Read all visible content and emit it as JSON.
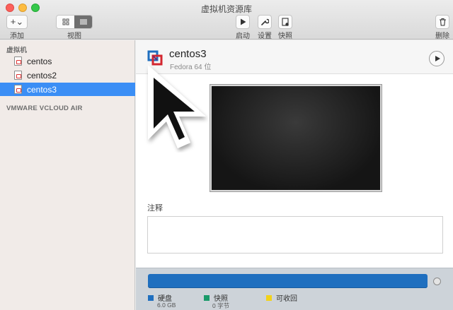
{
  "window": {
    "title": "虚拟机资源库"
  },
  "toolbar": {
    "add_glyph": "+⌄",
    "add_label": "添加",
    "view_label": "视图",
    "view_modes": [
      "grid",
      "list"
    ],
    "run_label": "启动",
    "settings_label": "设置",
    "snapshot_label": "快照",
    "delete_label": "删除"
  },
  "sidebar": {
    "section_vms": "虚拟机",
    "items": [
      {
        "label": "centos",
        "selected": false
      },
      {
        "label": "centos2",
        "selected": false
      },
      {
        "label": "centos3",
        "selected": true
      }
    ],
    "section_cloud": "VMWARE VCLOUD AIR"
  },
  "detail": {
    "name": "centos3",
    "os": "Fedora 64 位",
    "notes_label": "注释",
    "notes_value": ""
  },
  "storage": {
    "legend": [
      {
        "label": "硬盘",
        "value": "6.0 GB",
        "color": "#1f6fbf"
      },
      {
        "label": "快照",
        "value": "0 字节",
        "color": "#1a9a6a"
      },
      {
        "label": "可收回",
        "value": "",
        "color": "#f2d21a"
      }
    ]
  },
  "colors": {
    "selection": "#3b8ef5",
    "storage_bar": "#1f6fbf"
  },
  "icons": [
    "add-icon",
    "grid-view-icon",
    "list-view-icon",
    "play-icon",
    "wrench-icon",
    "snapshot-icon",
    "trash-icon",
    "vm-file-icon",
    "vmware-logo-icon",
    "mouse-pointer-icon"
  ]
}
